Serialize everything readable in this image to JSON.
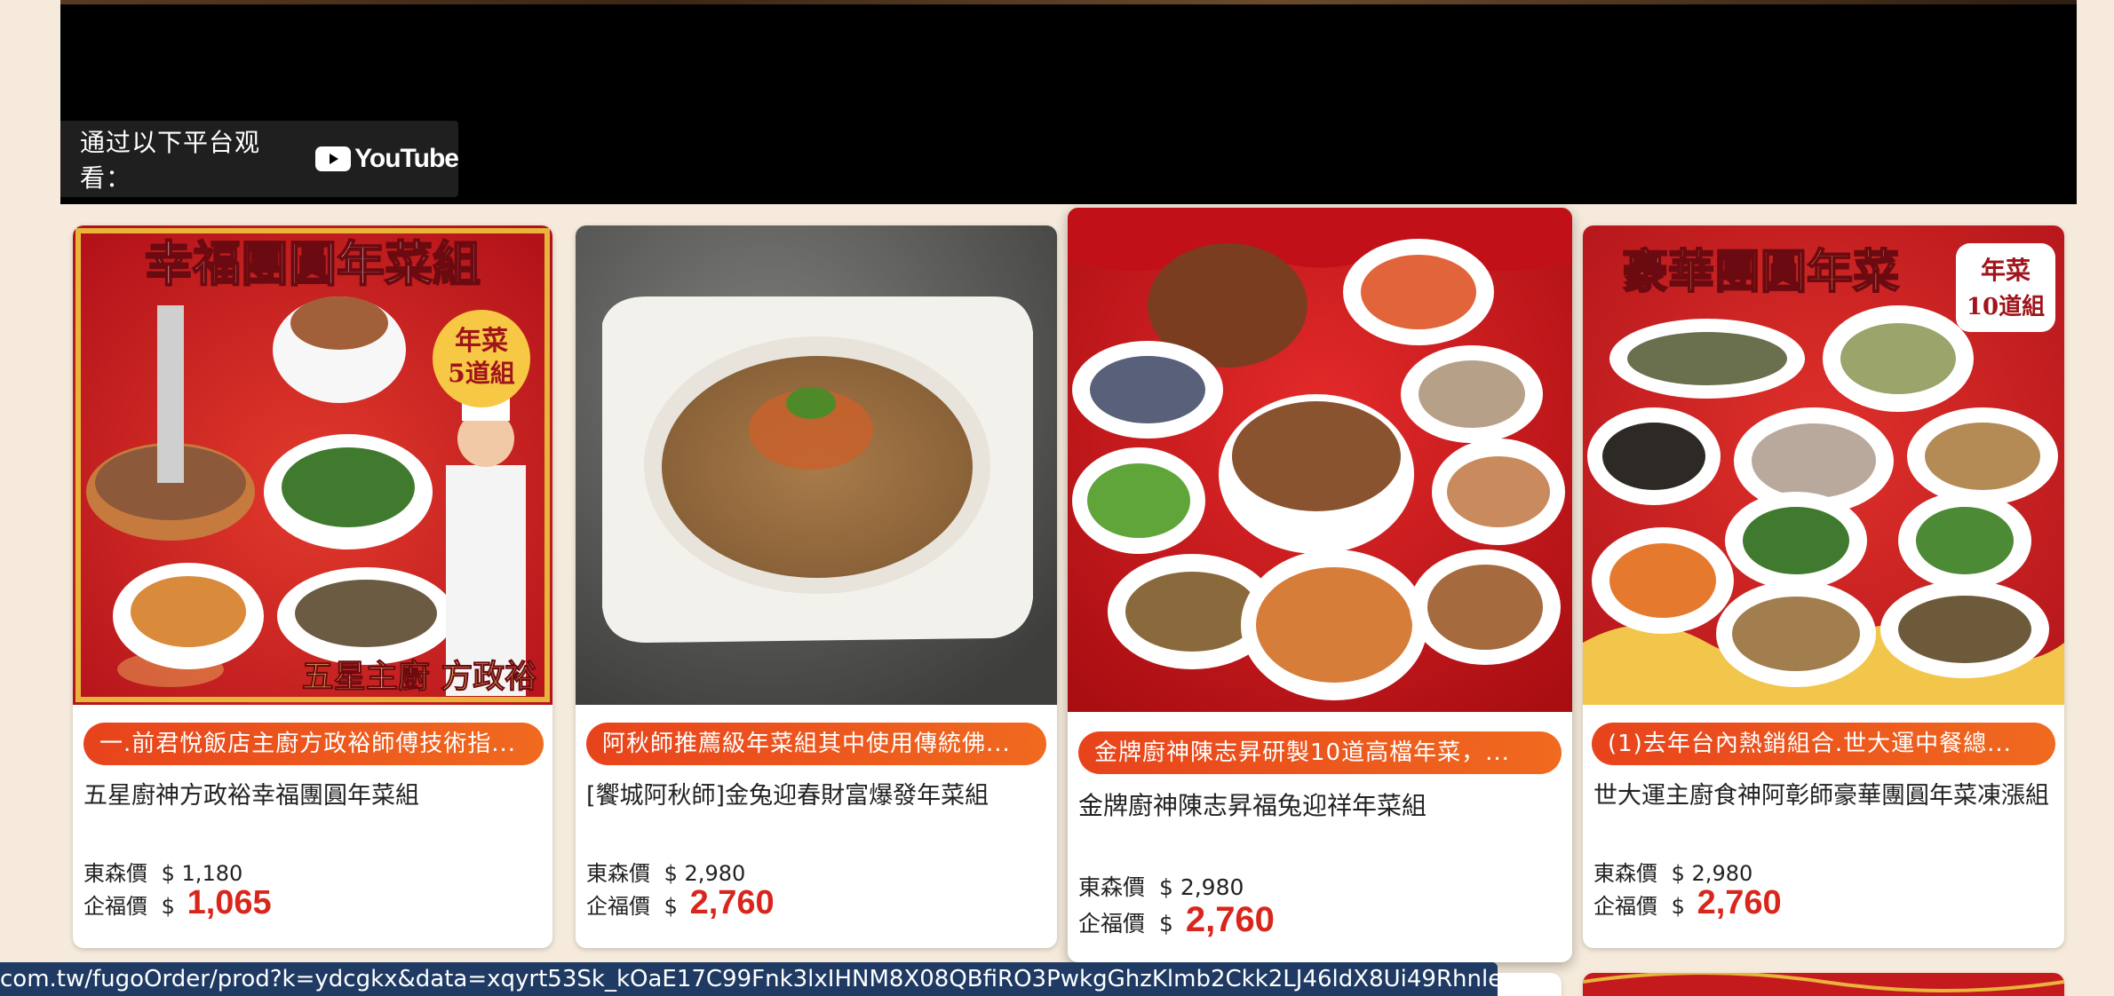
{
  "video": {
    "watch_on_label": "通过以下平台观看：",
    "platform": "YouTube"
  },
  "products": [
    {
      "image_caption": "幸福團圓年菜組",
      "image_badge": "年菜\n5道組",
      "image_footer": "五星主廚 方政裕",
      "promo": "一.前君悅飯店主廚方政裕師傅技術指...",
      "name": "五星廚神方政裕幸福團圓年菜組",
      "regular_price_label": "東森價",
      "regular_price": "$ 1,180",
      "member_price_label": "企福價",
      "member_price_currency": "$",
      "member_price": "1,065"
    },
    {
      "promo": "阿秋師推薦級年菜組其中使用傳統佛...",
      "name": "[饗城阿秋師]金兔迎春財富爆發年菜組",
      "regular_price_label": "東森價",
      "regular_price": "$ 2,980",
      "member_price_label": "企福價",
      "member_price_currency": "$",
      "member_price": "2,760"
    },
    {
      "promo": "金牌廚神陳志昇研製10道高檔年菜，...",
      "name": "金牌廚神陳志昇福兔迎祥年菜組",
      "regular_price_label": "東森價",
      "regular_price": "$ 2,980",
      "member_price_label": "企福價",
      "member_price_currency": "$",
      "member_price": "2,760"
    },
    {
      "image_caption": "豪華團圓年菜",
      "image_badge": "年菜\n10道組",
      "promo": "(1)去年台內熱銷組合.世大運中餐總...",
      "name": "世大運主廚食神阿彰師豪華團圓年菜凍漲組",
      "regular_price_label": "東森價",
      "regular_price": "$ 2,980",
      "member_price_label": "企福價",
      "member_price_currency": "$",
      "member_price": "2,760"
    }
  ],
  "status_bar": {
    "url": "com.tw/fugoOrder/prod?k=ydcgkx&data=xqyrt53Sk_kOaE17C99Fnk3lxIHNM8X08QBfiRO3PwkgGhzKlmb2Ckk2LJ46ldX8Ui49RhnleeTGQGTweFcnbA"
  },
  "colors": {
    "page_background": "#f5eadb",
    "promo_pill": "#ea4d1d",
    "price_highlight": "#d9261c",
    "status_bar": "#1f3a63"
  }
}
